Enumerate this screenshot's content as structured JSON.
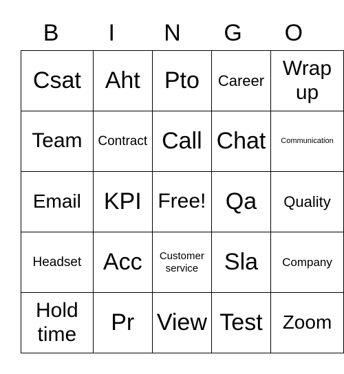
{
  "header": [
    "B",
    "I",
    "N",
    "G",
    "O"
  ],
  "cells": [
    [
      "Csat",
      "Aht",
      "Pto",
      "Career",
      "Wrap up"
    ],
    [
      "Team",
      "Contract",
      "Call",
      "Chat",
      "Communication"
    ],
    [
      "Email",
      "KPI",
      "Free!",
      "Qa",
      "Quality"
    ],
    [
      "Headset",
      "Acc",
      "Customer service",
      "Sla",
      "Company"
    ],
    [
      "Hold time",
      "Pr",
      "View",
      "Test",
      "Zoom"
    ]
  ]
}
